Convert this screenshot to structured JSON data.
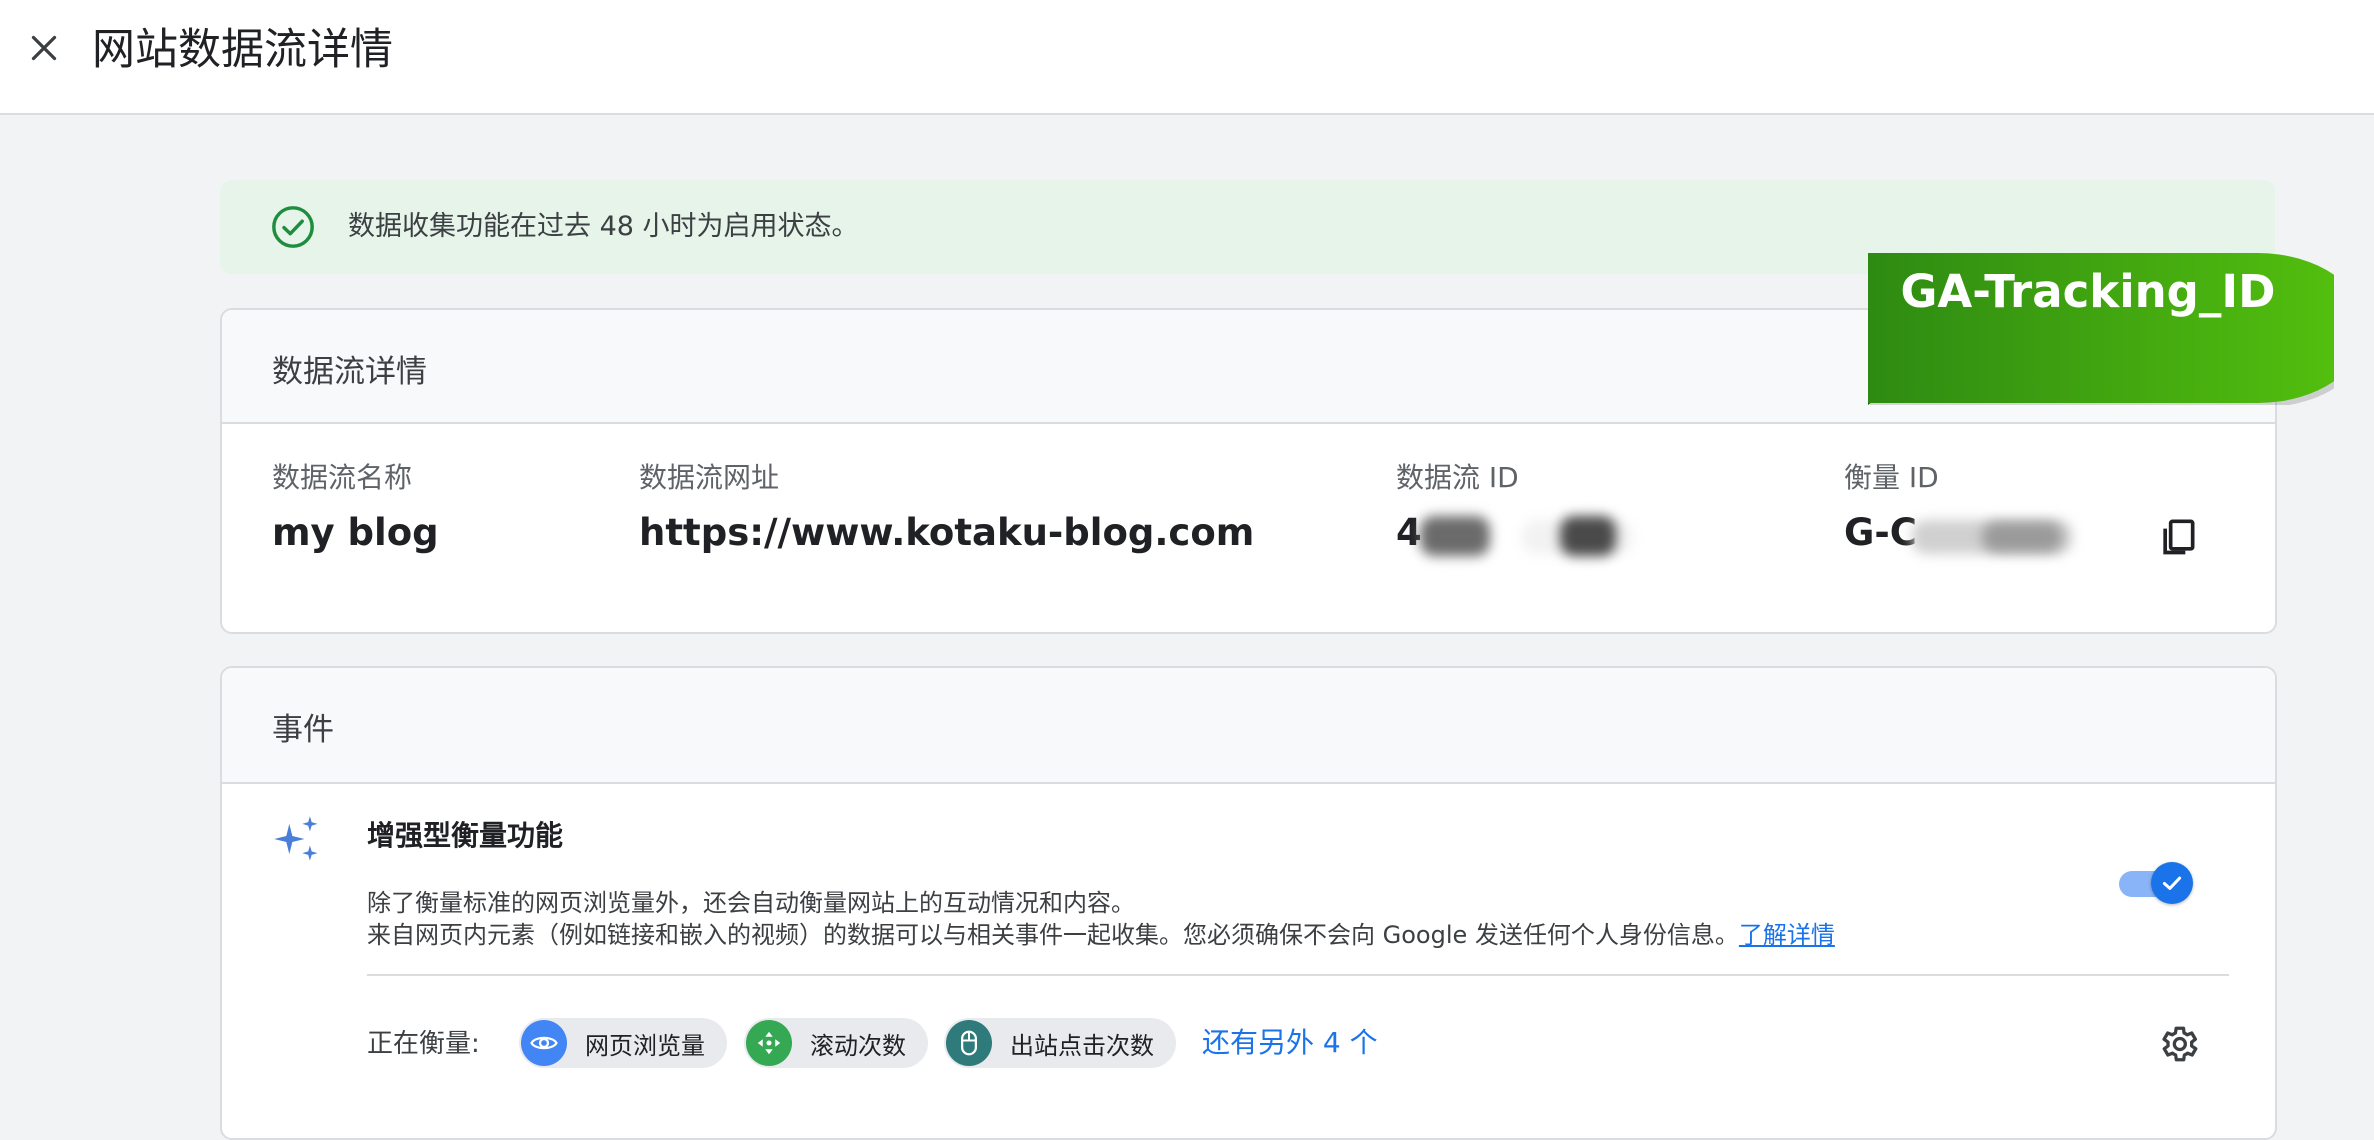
{
  "header": {
    "title": "网站数据流详情",
    "close_icon": "close-icon"
  },
  "banner": {
    "text": "数据收集功能在过去 48 小时为启用状态。",
    "icon": "check-circle-icon",
    "color": "#1e8e3e",
    "background": "#e6f4ea"
  },
  "stream_details": {
    "title": "数据流详情",
    "fields": [
      {
        "label": "数据流名称",
        "value": "my blog"
      },
      {
        "label": "数据流网址",
        "value": "https://www.kotaku-blog.com"
      },
      {
        "label": "数据流 ID",
        "value": "4"
      },
      {
        "label": "衡量 ID",
        "value": "G-C"
      }
    ],
    "copy_icon": "copy-icon"
  },
  "annotation": {
    "text": "GA-Tracking_ID",
    "color": "#3aa814"
  },
  "events": {
    "title": "事件",
    "enhanced": {
      "title": "增强型衡量功能",
      "desc_line1": "除了衡量标准的网页浏览量外，还会自动衡量网站上的互动情况和内容。",
      "desc_line2": "来自网页内元素（例如链接和嵌入的视频）的数据可以与相关事件一起收集。您必须确保不会向 Google 发送任何个人身份信息。",
      "learn_more": "了解详情",
      "toggle_on": true,
      "icon": "sparkle-icon"
    },
    "measuring_label": "正在衡量:",
    "chips": [
      {
        "label": "网页浏览量",
        "icon": "eye-icon",
        "color": "#4285f4"
      },
      {
        "label": "滚动次数",
        "icon": "scroll-icon",
        "color": "#34a853"
      },
      {
        "label": "出站点击次数",
        "icon": "mouse-icon",
        "color": "#2f7a7a"
      }
    ],
    "more_link": "还有另外 4 个",
    "settings_icon": "gear-icon"
  }
}
